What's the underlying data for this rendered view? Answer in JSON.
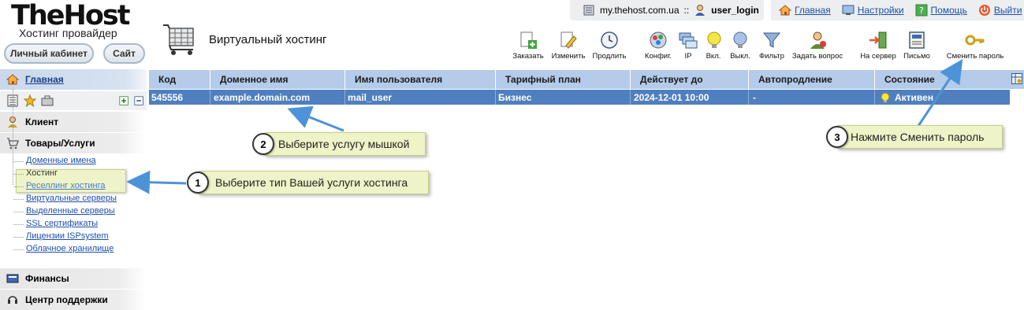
{
  "logo": {
    "main": "TheHost",
    "sub": "Хостинг провайдер"
  },
  "header_buttons": {
    "cabinet": "Личный кабинет",
    "site": "Сайт"
  },
  "page_title": "Виртуальный хостинг",
  "userbar": {
    "host": "my.thehost.com.ua",
    "separator": "::",
    "user": "user_login"
  },
  "top_links": {
    "home": "Главная",
    "settings": "Настройки",
    "help": "Помощь",
    "logout": "Выйти"
  },
  "toolbar": [
    {
      "label": "Заказать",
      "icon": "add-icon"
    },
    {
      "label": "Изменить",
      "icon": "edit-icon"
    },
    {
      "label": "Продлить",
      "icon": "clock-icon"
    },
    {
      "label": "Конфиг.",
      "icon": "config-icon"
    },
    {
      "label": "IP",
      "icon": "ip-icon"
    },
    {
      "label": "Вкл.",
      "icon": "bulb-on-icon"
    },
    {
      "label": "Выкл.",
      "icon": "bulb-off-icon"
    },
    {
      "label": "Фильтр",
      "icon": "filter-icon"
    },
    {
      "label": "Задать вопрос",
      "icon": "question-icon"
    },
    {
      "label": "На сервер",
      "icon": "to-server-icon"
    },
    {
      "label": "Письмо",
      "icon": "letter-icon"
    },
    {
      "label": "Сменить пароль",
      "icon": "key-icon"
    }
  ],
  "sidebar": {
    "main": "Главная",
    "client": "Клиент",
    "services": "Товары/Услуги",
    "items": [
      "Доменные имена",
      "Хостинг",
      "Реселлинг хостинга",
      "Виртуальные серверы",
      "Выделенные серверы",
      "SSL сертификаты",
      "Лицензии ISPsystem",
      "Облачное хранилище"
    ],
    "finance": "Финансы",
    "support": "Центр поддержки"
  },
  "table": {
    "columns": [
      "Код",
      "Доменное имя",
      "Имя пользователя",
      "Тарифный план",
      "Действует до",
      "Автопродление",
      "Состояние"
    ],
    "row": {
      "code": "545556",
      "domain": "example.domain.com",
      "user": "mail_user",
      "plan": "Бизнес",
      "until": "2024-12-01 10:00",
      "autorenew": "-",
      "status": "Активен"
    }
  },
  "callouts": [
    {
      "num": "1",
      "text": "Выберите тип Вашей услуги хостинга"
    },
    {
      "num": "2",
      "text": "Выберите услугу мышкой"
    },
    {
      "num": "3",
      "text": "Нажмите Сменить пароль"
    }
  ],
  "colors": {
    "header_bg": "#b4cbe9",
    "row_selected": "#4f7fbe",
    "callout_bg": "#eef3c8",
    "link": "#1d4fa8"
  }
}
